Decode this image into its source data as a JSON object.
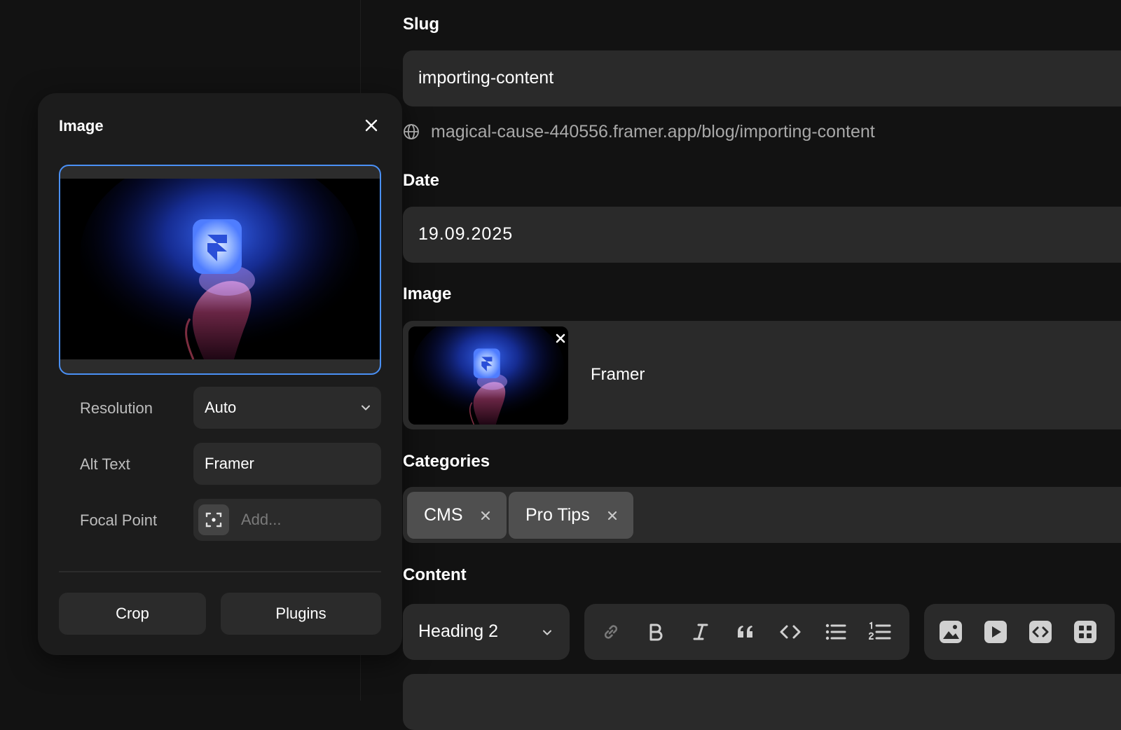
{
  "panel": {
    "title": "Image",
    "resolution": {
      "label": "Resolution",
      "value": "Auto"
    },
    "alt_text": {
      "label": "Alt Text",
      "value": "Framer"
    },
    "focal_point": {
      "label": "Focal Point",
      "placeholder": "Add..."
    },
    "crop_label": "Crop",
    "plugins_label": "Plugins"
  },
  "form": {
    "slug": {
      "label": "Slug",
      "value": "importing-content",
      "url": "magical-cause-440556.framer.app/blog/importing-content"
    },
    "date": {
      "label": "Date",
      "value": "19.09.2025"
    },
    "image": {
      "label": "Image",
      "name": "Framer"
    },
    "categories": {
      "label": "Categories",
      "items": [
        "CMS",
        "Pro Tips"
      ]
    },
    "content": {
      "label": "Content",
      "block_type": "Heading 2",
      "format_tools": [
        "link-icon",
        "bold-icon",
        "italic-icon",
        "quote-icon",
        "code-icon",
        "bullet-list-icon",
        "numbered-list-icon"
      ],
      "insert_tools": [
        "image-icon",
        "video-icon",
        "embed-icon",
        "component-icon"
      ]
    }
  },
  "colors": {
    "background": "#121212",
    "panel": "#1c1c1c",
    "field": "#2a2a2a",
    "chip": "#4f4f4f",
    "selection": "#4a90f5"
  }
}
